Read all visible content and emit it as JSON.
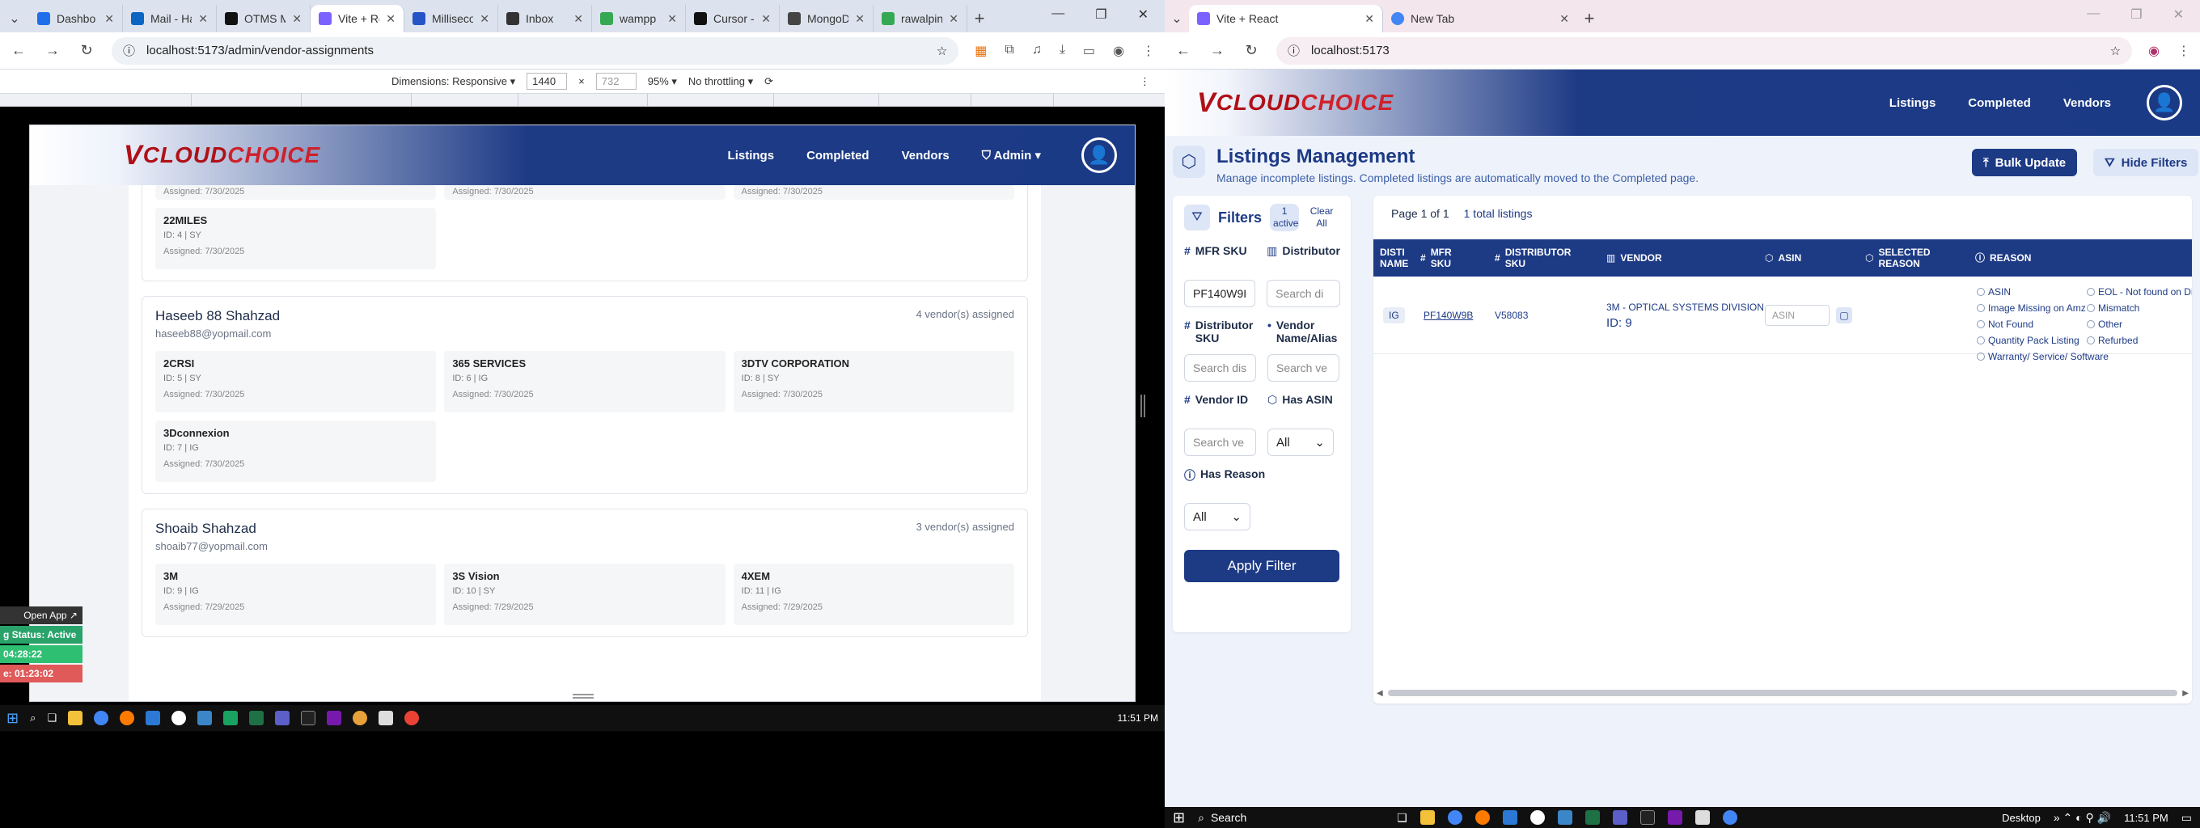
{
  "left": {
    "tabs": [
      {
        "label": "Dashbo",
        "color": "#1f6feb"
      },
      {
        "label": "Mail - Ha",
        "color": "#0a66c2"
      },
      {
        "label": "OTMS M",
        "color": "#111111"
      },
      {
        "label": "Vite + Re",
        "color": "#7b61ff",
        "active": true
      },
      {
        "label": "Millisecon",
        "color": "#2554c7"
      },
      {
        "label": "Inbox",
        "color": "#333333"
      },
      {
        "label": "wampp",
        "color": "#34a853"
      },
      {
        "label": "Cursor -",
        "color": "#111111"
      },
      {
        "label": "MongoD",
        "color": "#444444"
      },
      {
        "label": "rawalpin",
        "color": "#34a853"
      }
    ],
    "url": "localhost:5173/admin/vendor-assignments",
    "devtools": {
      "dimensions": "Dimensions: Responsive ▾",
      "width": "1440",
      "height": "732",
      "zoom": "95% ▾",
      "throttle": "No throttling ▾"
    },
    "header": {
      "nav": [
        "Listings",
        "Completed",
        "Vendors"
      ],
      "admin": "Admin ▾"
    },
    "top_partial": [
      {
        "s": "Assigned: 7/30/2025"
      },
      {
        "s": "Assigned: 7/30/2025"
      },
      {
        "s": "Assigned: 7/30/2025"
      }
    ],
    "first_extra": {
      "name": "22MILES",
      "sub": "ID: 4 | SY",
      "assigned": "Assigned: 7/30/2025"
    },
    "cards": [
      {
        "name": "Haseeb 88 Shahzad",
        "email": "haseeb88@yopmail.com",
        "count": "4 vendor(s) assigned",
        "vendors": [
          {
            "name": "2CRSI",
            "sub": "ID: 5 | SY",
            "assigned": "Assigned: 7/30/2025"
          },
          {
            "name": "365 SERVICES",
            "sub": "ID: 6 | IG",
            "assigned": "Assigned: 7/30/2025"
          },
          {
            "name": "3DTV CORPORATION",
            "sub": "ID: 8 | SY",
            "assigned": "Assigned: 7/30/2025"
          },
          {
            "name": "3Dconnexion",
            "sub": "ID: 7 | IG",
            "assigned": "Assigned: 7/30/2025"
          }
        ]
      },
      {
        "name": "Shoaib Shahzad",
        "email": "shoaib77@yopmail.com",
        "count": "3 vendor(s) assigned",
        "vendors": [
          {
            "name": "3M",
            "sub": "ID: 9 | IG",
            "assigned": "Assigned: 7/29/2025"
          },
          {
            "name": "3S Vision",
            "sub": "ID: 10 | SY",
            "assigned": "Assigned: 7/29/2025"
          },
          {
            "name": "4XEM",
            "sub": "ID: 11 | IG",
            "assigned": "Assigned: 7/29/2025"
          }
        ]
      }
    ],
    "widget": {
      "open": "Open App ↗",
      "status": "g Status: Active",
      "t1": "04:28:22",
      "t2": "e: 01:23:02"
    },
    "clock": "11:51 PM"
  },
  "right": {
    "tabs": [
      {
        "label": "Vite + React",
        "active": true
      },
      {
        "label": "New Tab"
      }
    ],
    "url": "localhost:5173",
    "header": {
      "nav": [
        "Listings",
        "Completed",
        "Vendors"
      ]
    },
    "title": "Listings Management",
    "subtitle": "Manage incomplete listings. Completed listings are automatically moved to the Completed page.",
    "bulk": "Bulk Update",
    "hide": "Hide Filters",
    "filters": {
      "title": "Filters",
      "badge": "1 active",
      "clear": "Clear All",
      "mfr_label": "MFR SKU",
      "mfr_value": "PF140W9I",
      "dist_label": "Distributor",
      "dist_ph": "Search di",
      "dsku_label": "Distributor SKU",
      "dsku_ph": "Search dis",
      "vname_label": "Vendor Name/Alias",
      "vname_ph": "Search ve",
      "vid_label": "Vendor ID",
      "vid_ph": "Search ve",
      "asin_label": "Has ASIN",
      "asin_val": "All",
      "reason_label": "Has Reason",
      "reason_val": "All",
      "apply": "Apply Filter"
    },
    "table": {
      "page": "Page 1 of 1",
      "total": "1 total listings",
      "cols": [
        "DISTI NAME",
        "MFR SKU",
        "DISTRIBUTOR SKU",
        "VENDOR",
        "ASIN",
        "SELECTED REASON",
        "REASON"
      ],
      "row": {
        "disti": "IG",
        "mfr": "PF140W9B",
        "dsku": "V58083",
        "vendor": "3M - OPTICAL SYSTEMS DIVISION",
        "vid": "ID: 9",
        "asin_ph": "ASIN"
      },
      "reasons": [
        "ASIN",
        "EOL - Not found on Dist",
        "Image Missing on Amz",
        "Mismatch",
        "Not Found",
        "Other",
        "Quantity Pack Listing",
        "Refurbed",
        "Warranty/ Service/ Software"
      ]
    },
    "search": "Search",
    "desktop": "Desktop",
    "clock": "11:51 PM"
  }
}
